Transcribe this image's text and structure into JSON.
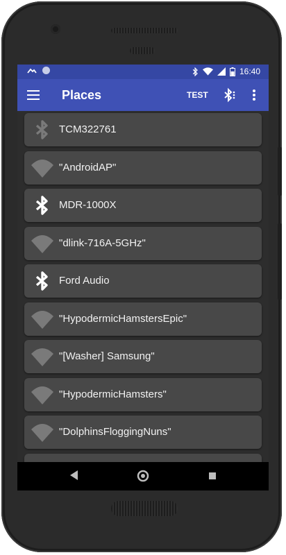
{
  "status_bar": {
    "time": "16:40"
  },
  "app_bar": {
    "title": "Places",
    "test_label": "TEST"
  },
  "colors": {
    "status": "#3547a4",
    "appbar": "#3f51b5",
    "card": "#484848",
    "background": "#2d2d2d"
  },
  "places": [
    {
      "name": "TCM322761",
      "icon": "bluetooth-icon",
      "state": "dim"
    },
    {
      "name": "\"AndroidAP\"",
      "icon": "wifi-icon",
      "state": "dim"
    },
    {
      "name": "MDR-1000X",
      "icon": "bluetooth-icon",
      "state": "active"
    },
    {
      "name": "\"dlink-716A-5GHz\"",
      "icon": "wifi-icon",
      "state": "dim"
    },
    {
      "name": "Ford Audio",
      "icon": "bluetooth-icon",
      "state": "active"
    },
    {
      "name": "\"HypodermicHamstersEpic\"",
      "icon": "wifi-icon",
      "state": "dim"
    },
    {
      "name": "\"[Washer] Samsung\"",
      "icon": "wifi-icon",
      "state": "dim"
    },
    {
      "name": "\"HypodermicHamsters\"",
      "icon": "wifi-icon",
      "state": "dim"
    },
    {
      "name": "\"DolphinsFloggingNuns\"",
      "icon": "wifi-icon",
      "state": "dim"
    },
    {
      "name": "",
      "icon": "wifi-icon",
      "state": "dim"
    }
  ]
}
